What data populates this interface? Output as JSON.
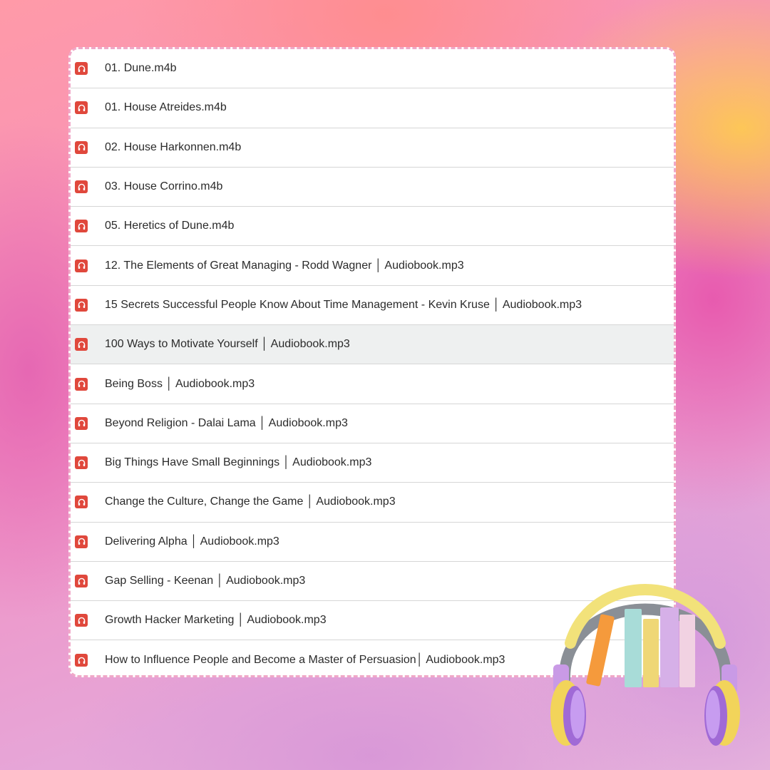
{
  "files": [
    {
      "name": "01. Dune.m4b",
      "highlighted": false
    },
    {
      "name": "01. House Atreides.m4b",
      "highlighted": false
    },
    {
      "name": "02. House Harkonnen.m4b",
      "highlighted": false
    },
    {
      "name": "03. House Corrino.m4b",
      "highlighted": false
    },
    {
      "name": "05. Heretics of Dune.m4b",
      "highlighted": false
    },
    {
      "name": "12. The Elements of Great Managing - Rodd Wagner │ Audiobook.mp3",
      "highlighted": false
    },
    {
      "name": "15 Secrets Successful People Know About Time Management - Kevin Kruse │ Audiobook.mp3",
      "highlighted": false
    },
    {
      "name": "100 Ways to Motivate Yourself │ Audiobook.mp3",
      "highlighted": true
    },
    {
      "name": "Being Boss │ Audiobook.mp3",
      "highlighted": false
    },
    {
      "name": "Beyond Religion - Dalai Lama │ Audiobook.mp3",
      "highlighted": false
    },
    {
      "name": "Big Things Have Small Beginnings  │ Audiobook.mp3",
      "highlighted": false
    },
    {
      "name": "Change the Culture, Change the Game │ Audiobook.mp3",
      "highlighted": false
    },
    {
      "name": "Delivering Alpha │ Audiobook.mp3",
      "highlighted": false
    },
    {
      "name": "Gap Selling - Keenan │ Audiobook.mp3",
      "highlighted": false
    },
    {
      "name": "Growth Hacker Marketing │ Audiobook.mp3",
      "highlighted": false
    },
    {
      "name": "How to Influence People and Become a Master of Persuasion│ Audiobook.mp3",
      "highlighted": false
    }
  ],
  "icons": {
    "file_icon": "headphones-file-icon",
    "illustration": "headphones-books-illustration"
  },
  "colors": {
    "file_icon_bg": "#e0483c",
    "highlight_row": "#eef0f0"
  }
}
